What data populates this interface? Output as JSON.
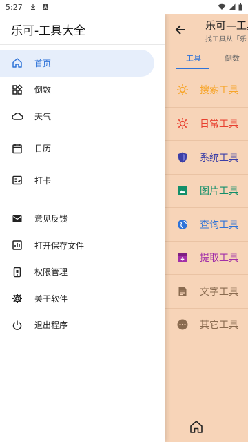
{
  "status_bar": {
    "time": "5:27",
    "left_icons": [
      "download-icon",
      "a-icon"
    ],
    "right_icons": [
      "wifi-icon",
      "signal-icon",
      "battery-icon"
    ]
  },
  "drawer": {
    "title": "乐可-工具大全",
    "items": [
      {
        "label": "首页",
        "icon": "home-icon",
        "active": true
      },
      {
        "label": "倒数",
        "icon": "apps-icon"
      },
      {
        "label": "天气",
        "icon": "cloud-icon"
      },
      {
        "label": "日历",
        "icon": "calendar-icon"
      },
      {
        "label": "打卡",
        "icon": "checkin-icon"
      },
      {
        "label": "意见反馈",
        "icon": "mail-icon"
      },
      {
        "label": "打开保存文件",
        "icon": "chart-icon"
      },
      {
        "label": "权限管理",
        "icon": "permission-icon"
      },
      {
        "label": "关于软件",
        "icon": "gear-icon"
      },
      {
        "label": "退出程序",
        "icon": "power-icon"
      }
    ]
  },
  "app": {
    "title": "乐可—工具",
    "subtitle": "找工具从「乐",
    "tabs": [
      "工具",
      "倒数"
    ],
    "tools": [
      {
        "label": "搜索工具",
        "icon": "sun-icon",
        "color": "#f7a52a"
      },
      {
        "label": "日常工具",
        "icon": "sun-icon",
        "color": "#e8402f"
      },
      {
        "label": "系统工具",
        "icon": "shield-icon",
        "color": "#3c3fa7"
      },
      {
        "label": "图片工具",
        "icon": "image-icon",
        "color": "#138f6a"
      },
      {
        "label": "查询工具",
        "icon": "globe-icon",
        "color": "#2f73d8"
      },
      {
        "label": "提取工具",
        "icon": "archive-icon",
        "color": "#a22fa8"
      },
      {
        "label": "文字工具",
        "icon": "document-icon",
        "color": "#8a6b50"
      },
      {
        "label": "其它工具",
        "icon": "more-icon",
        "color": "#8a6b50"
      }
    ],
    "bottom": {
      "icon": "home-icon"
    }
  },
  "colors": {
    "accent": "#2f73d8",
    "background": "#f7d4b8",
    "drawer_active_bg": "#e6eefb"
  }
}
